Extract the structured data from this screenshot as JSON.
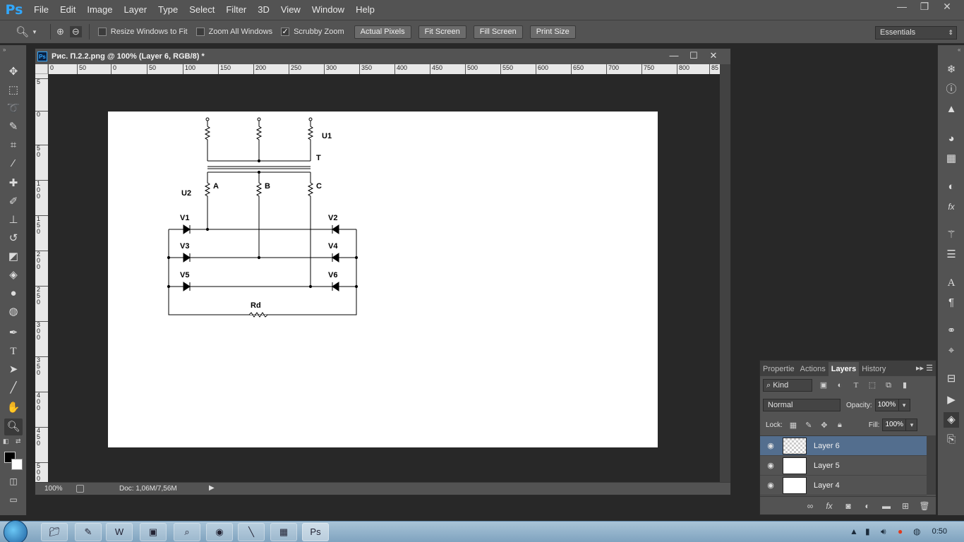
{
  "app": {
    "logo": "Ps",
    "menu": [
      "File",
      "Edit",
      "Image",
      "Layer",
      "Type",
      "Select",
      "Filter",
      "3D",
      "View",
      "Window",
      "Help"
    ],
    "window_controls": [
      "—",
      "❐",
      "✕"
    ]
  },
  "options_bar": {
    "tool_icon": "magnifier-icon",
    "checks": [
      {
        "label": "Resize Windows to Fit",
        "checked": false
      },
      {
        "label": "Zoom All Windows",
        "checked": false
      },
      {
        "label": "Scrubby Zoom",
        "checked": true
      }
    ],
    "buttons": [
      "Actual Pixels",
      "Fit Screen",
      "Fill Screen",
      "Print Size"
    ],
    "workspace": "Essentials"
  },
  "document": {
    "icon_label": "Ps",
    "title": "Рис. П.2.2.png @ 100% (Layer 6, RGB/8) *",
    "ruler_h": [
      "0",
      "50",
      "0",
      "50",
      "100",
      "150",
      "200",
      "250",
      "300",
      "350",
      "400",
      "450",
      "500",
      "550",
      "600",
      "650",
      "700",
      "750",
      "800",
      "85"
    ],
    "ruler_v": [
      "5",
      "0",
      "5\n0",
      "1\n0\n0",
      "1\n5\n0",
      "2\n0\n0",
      "2\n5\n0",
      "3\n0\n0",
      "3\n5\n0",
      "4\n0\n0",
      "4\n5\n0",
      "5\n0\n0"
    ],
    "zoom": "100%",
    "doc_size": "Doc: 1,06M/7,56M"
  },
  "circuit": {
    "U1": "U1",
    "T": "T",
    "U2": "U2",
    "A": "A",
    "B": "B",
    "C": "C",
    "V1": "V1",
    "V2": "V2",
    "V3": "V3",
    "V4": "V4",
    "V5": "V5",
    "V6": "V6",
    "Rd": "Rd"
  },
  "layers_panel": {
    "tabs": [
      "Propertie",
      "Actions",
      "Layers",
      "History"
    ],
    "active_tab": "Layers",
    "kind": "Kind",
    "blend_mode": "Normal",
    "opacity_label": "Opacity:",
    "opacity": "100%",
    "lock_label": "Lock:",
    "fill_label": "Fill:",
    "fill": "100%",
    "layers": [
      {
        "name": "Layer 6",
        "selected": true
      },
      {
        "name": "Layer 5",
        "selected": false
      },
      {
        "name": "Layer 4",
        "selected": false
      }
    ]
  },
  "taskbar": {
    "clock": "0:50"
  }
}
